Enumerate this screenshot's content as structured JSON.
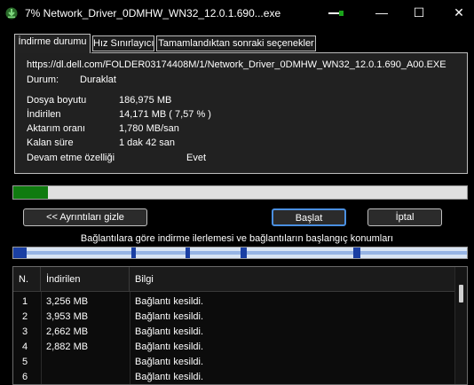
{
  "window": {
    "title": "7% Network_Driver_0DMHW_WN32_12.0.1.690...exe",
    "minimize_glyph": "—",
    "maximize_glyph": "☐",
    "close_glyph": "✕"
  },
  "tabs": [
    {
      "label": "İndirme durumu",
      "active": true
    },
    {
      "label": "Hız Sınırlayıcı",
      "active": false
    },
    {
      "label": "Tamamlandıktan sonraki seçenekler",
      "active": false
    }
  ],
  "info": {
    "url": "https://dl.dell.com/FOLDER03174408M/1/Network_Driver_0DMHW_WN32_12.0.1.690_A00.EXE",
    "status_label": "Durum:",
    "status_value": "Duraklat",
    "file_size_label": "Dosya boyutu",
    "file_size_value": "186,975  MB",
    "downloaded_label": "İndirilen",
    "downloaded_value": "14,171  MB  ( 7,57 % )",
    "rate_label": "Aktarım oranı",
    "rate_value": "1,780  MB/san",
    "remaining_label": "Kalan süre",
    "remaining_value": "1 dak 42 san",
    "resume_label": "Devam etme özelliği",
    "resume_value": "Evet"
  },
  "progress": {
    "fraction": 0.0757,
    "color": "#0f7b0f"
  },
  "buttons": {
    "details": "<< Ayrıntıları gizle",
    "start": "Başlat",
    "cancel": "İptal"
  },
  "connections_label": "Bağlantılara göre indirme ilerlemesi ve bağlantıların başlangıç konumları",
  "connection_segments": [
    {
      "start": 0.0,
      "width": 0.03
    },
    {
      "start": 0.26,
      "width": 0.01
    },
    {
      "start": 0.38,
      "width": 0.01
    },
    {
      "start": 0.5,
      "width": 0.015
    },
    {
      "start": 0.75,
      "width": 0.015
    }
  ],
  "table": {
    "headers": [
      "N.",
      "İndirilen",
      "Bilgi"
    ],
    "rows": [
      {
        "n": "1",
        "downloaded": "3,256  MB",
        "info": "Bağlantı kesildi."
      },
      {
        "n": "2",
        "downloaded": "3,953  MB",
        "info": "Bağlantı kesildi."
      },
      {
        "n": "3",
        "downloaded": "2,662  MB",
        "info": "Bağlantı kesildi."
      },
      {
        "n": "4",
        "downloaded": "2,882  MB",
        "info": "Bağlantı kesildi."
      },
      {
        "n": "5",
        "downloaded": "",
        "info": "Bağlantı kesildi."
      },
      {
        "n": "6",
        "downloaded": "",
        "info": "Bağlantı kesildi."
      }
    ]
  }
}
